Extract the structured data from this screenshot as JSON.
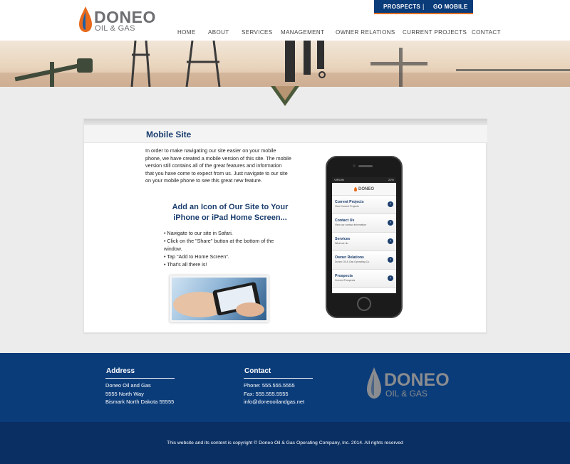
{
  "brand": {
    "name": "DONEO",
    "sub": "OIL & GAS"
  },
  "topbar": {
    "prospects": "PROSPECTS",
    "separator": "|",
    "go_mobile": "GO MOBILE"
  },
  "nav": [
    "HOME",
    "ABOUT",
    "SERVICES",
    "MANAGEMENT",
    "OWNER RELATIONS",
    "CURRENT PROJECTS",
    "CONTACT"
  ],
  "main": {
    "title": "Mobile Site",
    "intro": "In order to make navigating our site easier on your mobile phone, we have created a mobile version of this site. The mobile version still contains all of the great features and information that you have come to expect from us. Just navigate to our site on your mobile phone to see this great new feature.",
    "subhead": "Add an Icon of Our Site to Your iPhone or iPad Home Screen...",
    "bullets": [
      "Navigate to our site in Safari.",
      "Click on the \"Share\" button at the bottom of the window.",
      "Tap \"Add to Home Screen\".",
      "That's all there is!"
    ]
  },
  "phone": {
    "carrier": "VIRGIN",
    "battery": "22%",
    "logo": "DONEO",
    "items": [
      {
        "title": "Current Projects",
        "sub": "View Current Projects"
      },
      {
        "title": "Contact Us",
        "sub": "View our contact information"
      },
      {
        "title": "Services",
        "sub": "What we do"
      },
      {
        "title": "Owner Relations",
        "sub": "Doneo Oil & Gas Operating Co."
      },
      {
        "title": "Prospects",
        "sub": "Current Prospects"
      }
    ]
  },
  "footer": {
    "address_head": "Address",
    "address": [
      "Doneo Oil and Gas",
      "5555 North Way",
      "Bismark North Dakota 55555"
    ],
    "contact_head": "Contact",
    "contact": [
      "Phone: 555.555.5555",
      "Fax: 555.555.5555",
      "info@doneooilandgas.net"
    ],
    "logo_name": "DONEO",
    "logo_sub": "OIL & GAS"
  },
  "copyright": "This website and its content is copyright © Doneo Oil & Gas Operating Company, Inc. 2014. All rights reserved",
  "colors": {
    "navy": "#0b3c7a",
    "orange": "#e06c1f",
    "title_blue": "#1a3d6e"
  }
}
